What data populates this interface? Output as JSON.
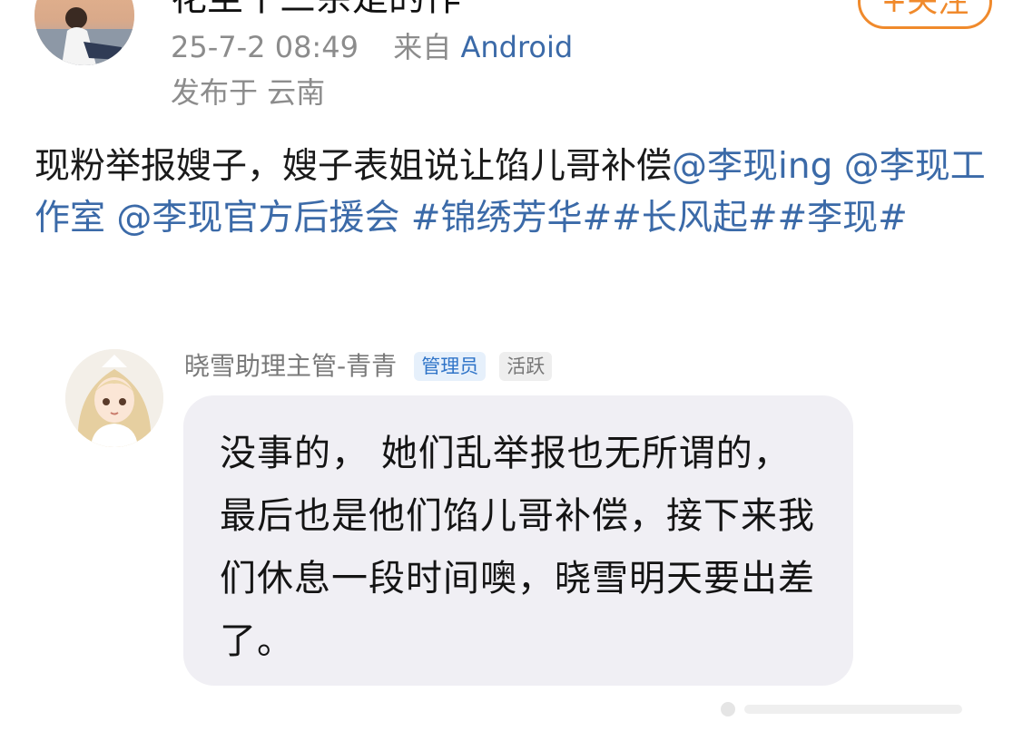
{
  "post": {
    "author_name": "花至十三余是的作",
    "follow_label": "+关注",
    "timestamp": "25-7-2 08:49",
    "from_label": "来自",
    "source": "Android",
    "location": "发布于 云南",
    "content": [
      {
        "text": "现粉举报嫂子，嫂子表姐说让馅儿哥补偿",
        "type": "text"
      },
      {
        "text": "@李现ing @李现工作室 @李现官方后援会 #锦绣芳华##长风起##李现#",
        "type": "link"
      }
    ]
  },
  "comment": {
    "username": "晓雪助理主管-青青",
    "badge_admin": "管理员",
    "badge_active": "活跃",
    "text": "没事的， 她们乱举报也无所谓的，最后也是他们馅儿哥补偿，接下来我们休息一段时间噢，晓雪明天要出差了。"
  },
  "colors": {
    "link": "#3b6aa8",
    "follow": "#f08a2c",
    "meta": "#8c8c8c",
    "bubble": "#f0eff4",
    "admin_badge_text": "#2f74c8"
  }
}
